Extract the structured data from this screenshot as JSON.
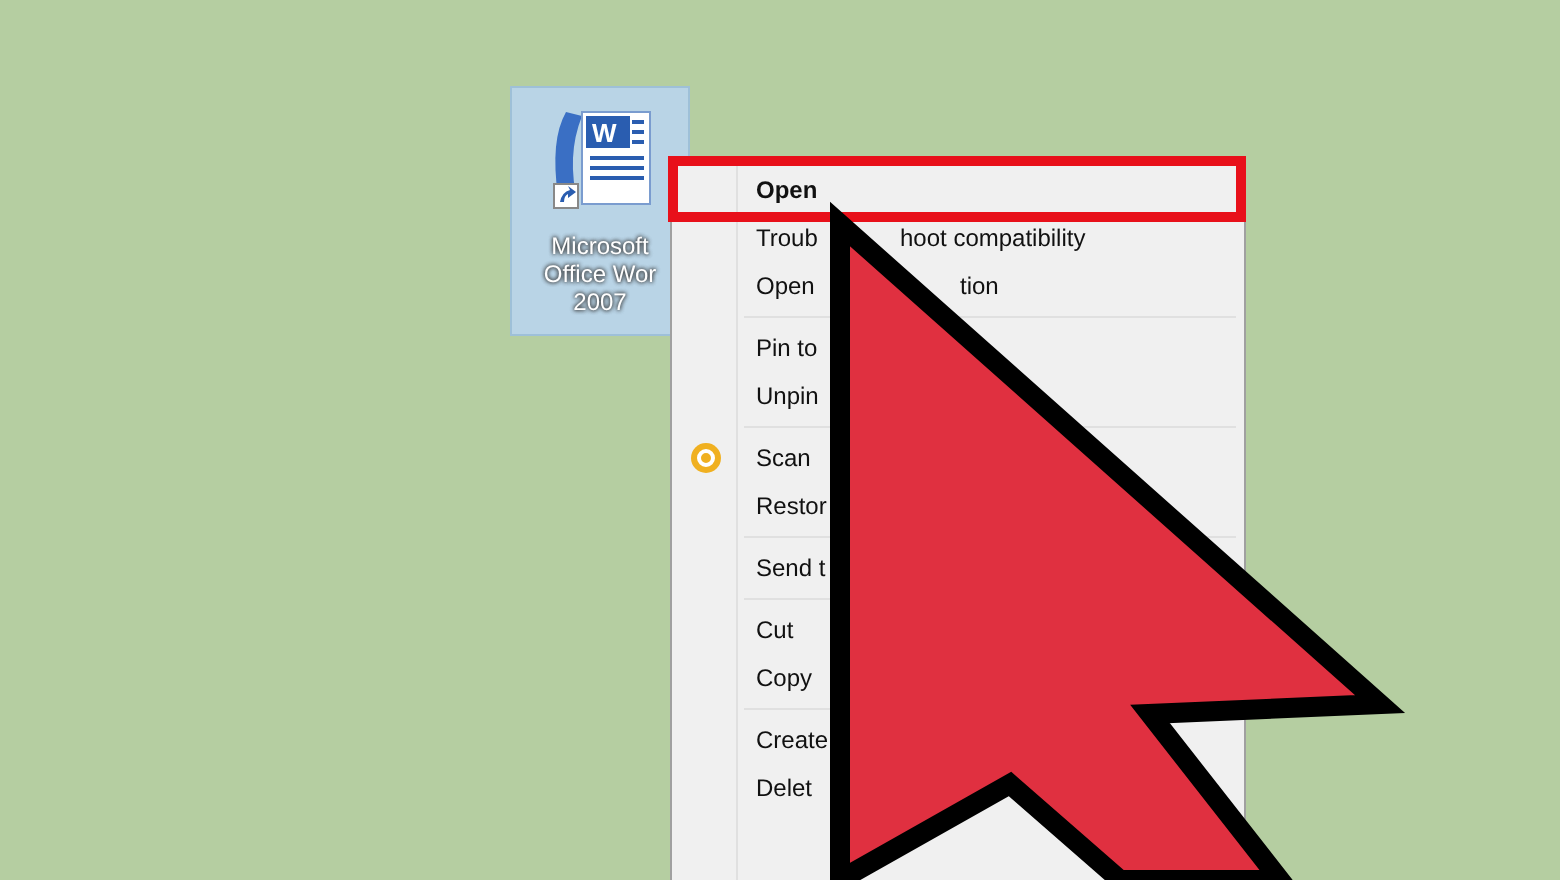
{
  "desktop_icon": {
    "logo_letter": "W",
    "label_lines": [
      "Microsoft",
      "Office Wor",
      "2007"
    ],
    "selected": true
  },
  "context_menu": {
    "items": [
      {
        "kind": "item",
        "text": "Open",
        "default": true
      },
      {
        "kind": "item",
        "text": "Troub",
        "text_after": "hoot compatibility",
        "default": false
      },
      {
        "kind": "item",
        "text": "Open",
        "text_after": "tion",
        "default": false
      },
      {
        "kind": "separator"
      },
      {
        "kind": "item",
        "text": "Pin to",
        "default": false
      },
      {
        "kind": "item",
        "text": "Unpin",
        "default": false
      },
      {
        "kind": "separator"
      },
      {
        "kind": "icon_item",
        "text": "Scan",
        "default": false
      },
      {
        "kind": "item",
        "text": "Restor",
        "default": false
      },
      {
        "kind": "separator"
      },
      {
        "kind": "item",
        "text": "Send t",
        "default": false
      },
      {
        "kind": "separator"
      },
      {
        "kind": "item",
        "text": "Cut",
        "default": false
      },
      {
        "kind": "item",
        "text": "Copy",
        "default": false
      },
      {
        "kind": "separator"
      },
      {
        "kind": "item",
        "text": "Create",
        "default": false
      },
      {
        "kind": "item",
        "text": "Delet",
        "default": false
      }
    ]
  }
}
